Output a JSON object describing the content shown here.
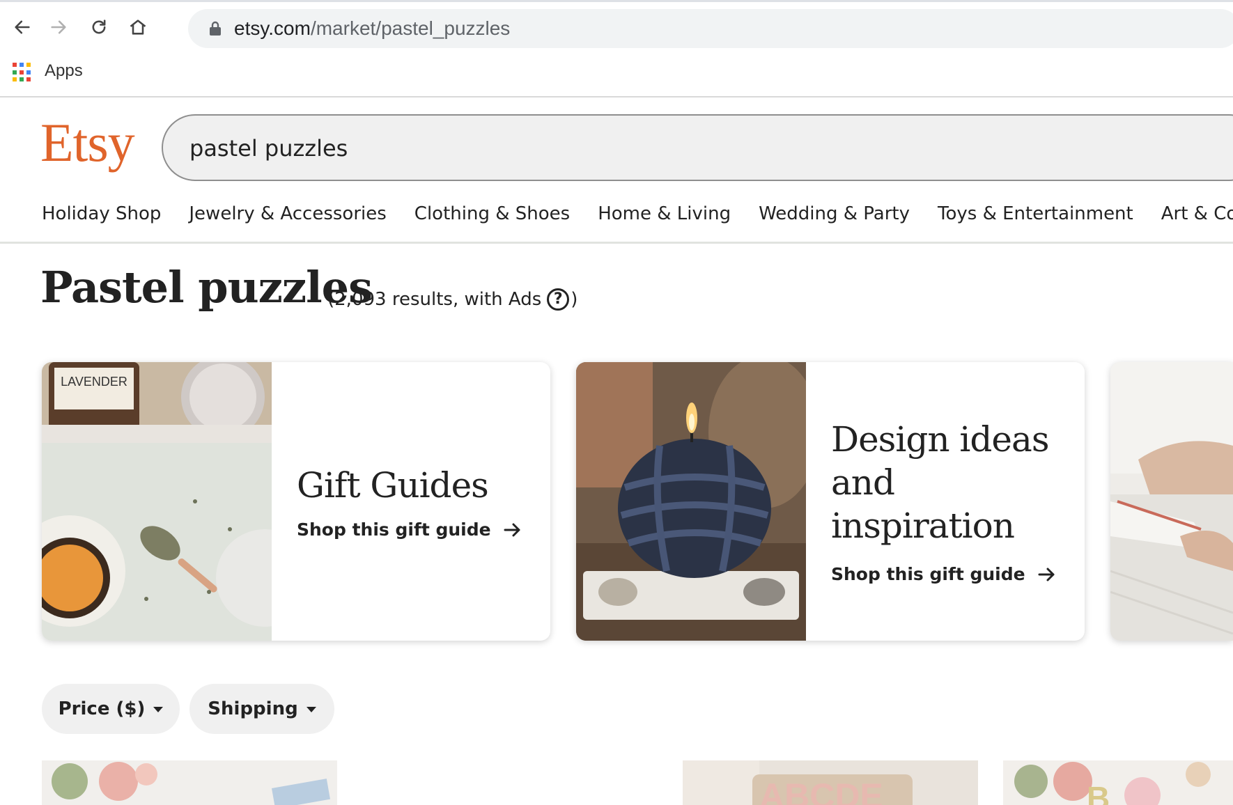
{
  "browser": {
    "url_domain": "etsy.com",
    "url_path": "/market/pastel_puzzles",
    "bookmarks": {
      "apps_label": "Apps"
    }
  },
  "header": {
    "logo": "Etsy",
    "search_value": "pastel puzzles",
    "categories": [
      "Holiday Shop",
      "Jewelry & Accessories",
      "Clothing & Shoes",
      "Home & Living",
      "Wedding & Party",
      "Toys & Entertainment",
      "Art & Collecti"
    ]
  },
  "results": {
    "title": "Pastel puzzles",
    "count_prefix": "(2,093 results, with Ads",
    "count_suffix": ")",
    "help_glyph": "?"
  },
  "cards": [
    {
      "title": "Gift Guides",
      "link": "Shop this gift guide"
    },
    {
      "title_lines": [
        "Design ideas",
        "and",
        "inspiration"
      ],
      "link": "Shop this gift guide"
    }
  ],
  "filters": {
    "price_label": "Price ($)",
    "shipping_label": "Shipping"
  },
  "colors": {
    "brand": "#e0642b",
    "text": "#222222",
    "pill_bg": "#f0f0f0"
  },
  "icons": [
    "back-arrow-icon",
    "forward-arrow-icon",
    "reload-icon",
    "home-icon",
    "lock-icon",
    "apps-grid-icon",
    "help-circle-icon",
    "right-arrow-icon",
    "caret-down-icon"
  ]
}
